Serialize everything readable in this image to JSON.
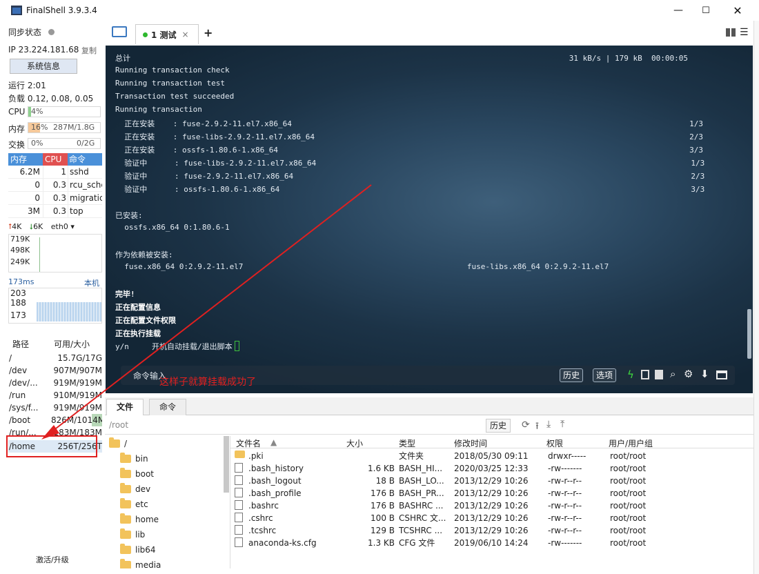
{
  "window": {
    "title": "FinalShell 3.9.3.4"
  },
  "sidebar": {
    "sync_label": "同步状态",
    "ip": "IP 23.224.181.68",
    "copy": "复制",
    "sysinfo": "系统信息",
    "uptime": "运行 2:01",
    "load": "负载 0.12, 0.08, 0.05",
    "cpu_label": "CPU",
    "cpu_value": "4%",
    "cpu_pct": 4,
    "mem_label": "内存",
    "mem_pct_text": "16%",
    "mem_value": "287M/1.8G",
    "mem_pct": 16,
    "swap_label": "交换",
    "swap_pct_text": "0%",
    "swap_value": "0/2G",
    "proc_headers": [
      "内存",
      "CPU",
      "命令"
    ],
    "processes": [
      {
        "mem": "6.2M",
        "cpu": "1",
        "cmd": "sshd"
      },
      {
        "mem": "0",
        "cpu": "0.3",
        "cmd": "rcu_sche"
      },
      {
        "mem": "0",
        "cpu": "0.3",
        "cmd": "migratic"
      },
      {
        "mem": "3M",
        "cpu": "0.3",
        "cmd": "top"
      }
    ],
    "net_up": "4K",
    "net_down": "6K",
    "net_if": "eth0",
    "net_ticks": [
      "719K",
      "498K",
      "249K"
    ],
    "ping_latency": "173ms",
    "ping_host": "本机",
    "ping_ticks": [
      "203",
      "188",
      "173"
    ],
    "disk_headers": [
      "路径",
      "可用/大小"
    ],
    "disks": [
      {
        "path": "/",
        "size": "15.7G/17G"
      },
      {
        "path": "/dev",
        "size": "907M/907M"
      },
      {
        "path": "/dev/...",
        "size": "919M/919M"
      },
      {
        "path": "/run",
        "size": "910M/919M"
      },
      {
        "path": "/sys/f...",
        "size": "919M/919M"
      },
      {
        "path": "/boot",
        "size": "826M/1014M"
      },
      {
        "path": "/run/...",
        "size": "183M/183M"
      },
      {
        "path": "/home",
        "size": "256T/256T"
      }
    ],
    "activate": "激活/升级"
  },
  "tabs": {
    "session": "1 测试",
    "close": "×",
    "add": "+"
  },
  "terminal": {
    "lines": [
      "总计                                                                                                31 kB/s | 179 kB  00:00:05",
      "Running transaction check",
      "Running transaction test",
      "Transaction test succeeded",
      "Running transaction",
      "  正在安装    : fuse-2.9.2-11.el7.x86_64                                                                                       1/3",
      "  正在安装    : fuse-libs-2.9.2-11.el7.x86_64                                                                                  2/3",
      "  正在安装    : ossfs-1.80.6-1.x86_64                                                                                          3/3",
      "  验证中      : fuse-libs-2.9.2-11.el7.x86_64                                                                                  1/3",
      "  验证中      : fuse-2.9.2-11.el7.x86_64                                                                                       2/3",
      "  验证中      : ossfs-1.80.6-1.x86_64                                                                                          3/3",
      "",
      "已安装:",
      "  ossfs.x86_64 0:1.80.6-1",
      "",
      "作为依赖被安装:",
      "  fuse.x86_64 0:2.9.2-11.el7                                                 fuse-libs.x86_64 0:2.9.2-11.el7",
      "",
      "完毕!",
      "正在配置信息",
      "正在配置文件权限",
      "正在执行挂载",
      "y/n     开机自动挂载/退出脚本"
    ],
    "cmd_label": "命令输入",
    "history_btn": "历史",
    "options_btn": "选项",
    "annotation": "这样子就算挂载成功了"
  },
  "filepanel": {
    "tab_files": "文件",
    "tab_cmd": "命令",
    "path": "/root",
    "history": "历史",
    "tree_root": "/",
    "tree": [
      "bin",
      "boot",
      "dev",
      "etc",
      "home",
      "lib",
      "lib64",
      "media"
    ],
    "headers": [
      "文件名",
      "大小",
      "类型",
      "修改时间",
      "权限",
      "用户/用户组"
    ],
    "files": [
      {
        "name": ".pki",
        "size": "",
        "type": "文件夹",
        "mtime": "2018/05/30 09:11",
        "perm": "drwxr-----",
        "owner": "root/root",
        "dir": true
      },
      {
        "name": ".bash_history",
        "size": "1.6 KB",
        "type": "BASH_HI...",
        "mtime": "2020/03/25 12:33",
        "perm": "-rw-------",
        "owner": "root/root"
      },
      {
        "name": ".bash_logout",
        "size": "18 B",
        "type": "BASH_LO...",
        "mtime": "2013/12/29 10:26",
        "perm": "-rw-r--r--",
        "owner": "root/root"
      },
      {
        "name": ".bash_profile",
        "size": "176 B",
        "type": "BASH_PR...",
        "mtime": "2013/12/29 10:26",
        "perm": "-rw-r--r--",
        "owner": "root/root"
      },
      {
        "name": ".bashrc",
        "size": "176 B",
        "type": "BASHRC ...",
        "mtime": "2013/12/29 10:26",
        "perm": "-rw-r--r--",
        "owner": "root/root"
      },
      {
        "name": ".cshrc",
        "size": "100 B",
        "type": "CSHRC 文...",
        "mtime": "2013/12/29 10:26",
        "perm": "-rw-r--r--",
        "owner": "root/root"
      },
      {
        "name": ".tcshrc",
        "size": "129 B",
        "type": "TCSHRC ...",
        "mtime": "2013/12/29 10:26",
        "perm": "-rw-r--r--",
        "owner": "root/root"
      },
      {
        "name": "anaconda-ks.cfg",
        "size": "1.3 KB",
        "type": "CFG 文件",
        "mtime": "2019/06/10 14:24",
        "perm": "-rw-------",
        "owner": "root/root"
      }
    ]
  },
  "colors": {
    "accent": "#4a90d9",
    "annotation": "#e02020",
    "terminal_bg": "#1f3a50"
  }
}
